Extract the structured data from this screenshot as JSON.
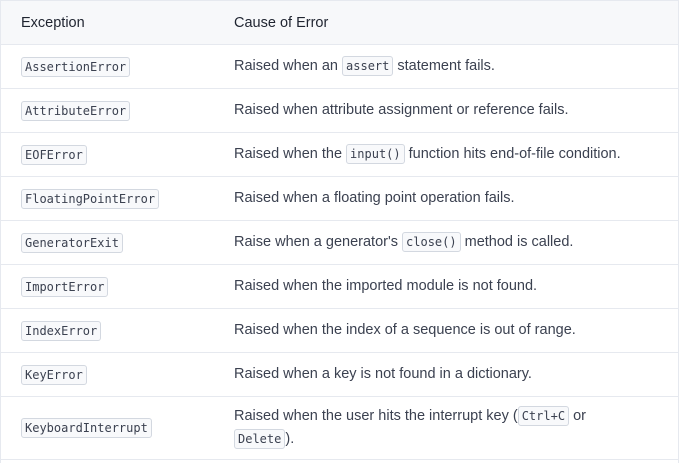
{
  "table": {
    "headers": [
      "Exception",
      "Cause of Error"
    ],
    "rows": [
      {
        "exception": "AssertionError",
        "cause": [
          {
            "t": "Raised when an "
          },
          {
            "c": "assert"
          },
          {
            "t": " statement fails."
          }
        ]
      },
      {
        "exception": "AttributeError",
        "cause": [
          {
            "t": "Raised when attribute assignment or reference fails."
          }
        ]
      },
      {
        "exception": "EOFError",
        "cause": [
          {
            "t": "Raised when the "
          },
          {
            "c": "input()"
          },
          {
            "t": " function hits end-of-file condition."
          }
        ]
      },
      {
        "exception": "FloatingPointError",
        "cause": [
          {
            "t": "Raised when a floating point operation fails."
          }
        ]
      },
      {
        "exception": "GeneratorExit",
        "cause": [
          {
            "t": "Raise when a generator's "
          },
          {
            "c": "close()"
          },
          {
            "t": " method is called."
          }
        ]
      },
      {
        "exception": "ImportError",
        "cause": [
          {
            "t": "Raised when the imported module is not found."
          }
        ]
      },
      {
        "exception": "IndexError",
        "cause": [
          {
            "t": "Raised when the index of a sequence is out of range."
          }
        ]
      },
      {
        "exception": "KeyError",
        "cause": [
          {
            "t": "Raised when a key is not found in a dictionary."
          }
        ]
      },
      {
        "exception": "KeyboardInterrupt",
        "cause": [
          {
            "t": "Raised when the user hits the interrupt key ("
          },
          {
            "c": "Ctrl+C"
          },
          {
            "t": " or "
          },
          {
            "br": true
          },
          {
            "c": "Delete"
          },
          {
            "t": ")."
          }
        ]
      }
    ]
  }
}
